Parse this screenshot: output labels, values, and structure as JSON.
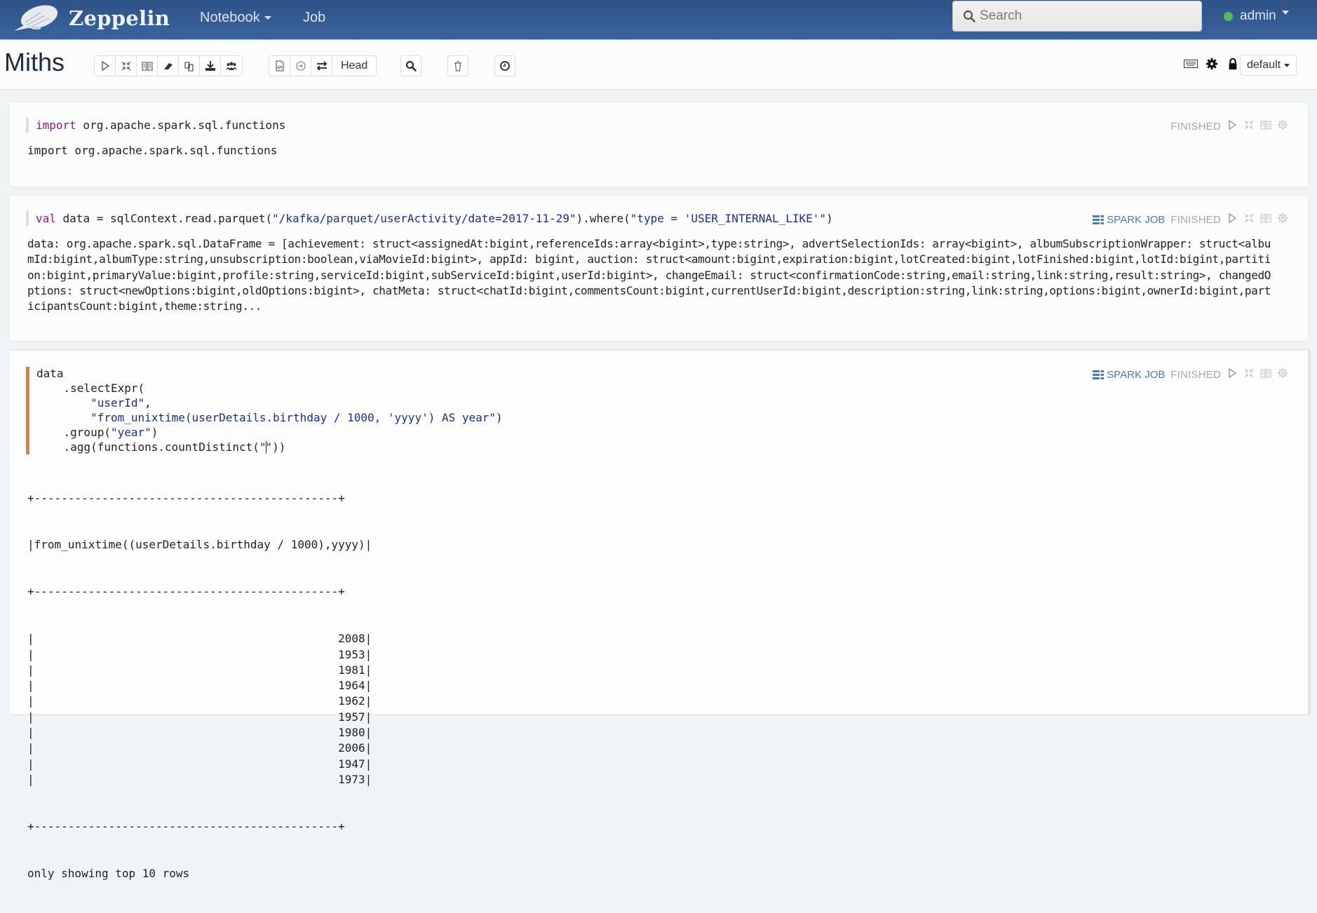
{
  "navbar": {
    "brand": "Zeppelin",
    "menu": [
      {
        "label": "Notebook",
        "has_dropdown": true
      },
      {
        "label": "Job",
        "has_dropdown": false
      }
    ],
    "search": {
      "placeholder": "Search",
      "value": ""
    },
    "user": {
      "name": "admin",
      "status_color": "#5cb85c"
    }
  },
  "notebook": {
    "title": "Miths",
    "toolbar": {
      "group1": [
        "run-all-icon",
        "collapse-icon",
        "book-icon",
        "eraser-icon",
        "copy-icon",
        "download-icon",
        "users-icon"
      ],
      "group2": [
        "code-file-icon",
        "commit-icon",
        "swap-icon"
      ],
      "head_label": "Head",
      "search_icon": "search-icon",
      "delete_icon": "trash-icon",
      "schedule_icon": "clock-icon"
    },
    "right_tools": [
      "keyboard-icon",
      "gear-icon",
      "lock-icon"
    ],
    "interpreter_select": "default"
  },
  "paragraphs": [
    {
      "code": "import org.apache.spark.sql.functions",
      "code_keyword": "import",
      "code_rest": " org.apache.spark.sql.functions",
      "output": "import org.apache.spark.sql.functions",
      "status": "FINISHED",
      "spark_job": null
    },
    {
      "code_keyword": "val",
      "code_pre": " data = sqlContext.read.parquet(",
      "code_str1": "\"/kafka/parquet/userActivity/date=2017-11-29\"",
      "code_mid": ").where(",
      "code_str2": "\"type = 'USER_INTERNAL_LIKE'\"",
      "code_post": ")",
      "output_lines": [
        "data: org.apache.spark.sql.DataFrame = [achievement: struct<assignedAt:bigint,referenceIds:array<bigint>,type:string>, advertSelectionIds: array<bigint>, albumSubscriptionWrapper: struct<albu",
        "mId:bigint,albumType:string,unsubscription:boolean,viaMovieId:bigint>, appId: bigint, auction: struct<amount:bigint,expiration:bigint,lotCreated:bigint,lotFinished:bigint,lotId:bigint,partiti",
        "on:bigint,primaryValue:bigint,profile:string,serviceId:bigint,subServiceId:bigint,userId:bigint>, changeEmail: struct<confirmationCode:string,email:string,link:string,result:string>, changedO",
        "ptions: struct<newOptions:bigint,oldOptions:bigint>, chatMeta: struct<chatId:bigint,commentsCount:bigint,currentUserId:bigint,description:string,link:string,options:bigint,ownerId:bigint,part",
        "icipantsCount:bigint,theme:string..."
      ],
      "status": "FINISHED",
      "spark_job": "SPARK JOB"
    },
    {
      "code_lines": [
        {
          "plain": "data"
        },
        {
          "plain": "    .selectExpr("
        },
        {
          "str": "        \"userId\"",
          "plain_after": ","
        },
        {
          "str": "        \"from_unixtime(userDetails.birthday / 1000, 'yyyy') AS year\"",
          "plain_after": ")"
        },
        {
          "plain": "    .group(",
          "str": "\"year\"",
          "plain_after": ")"
        },
        {
          "plain": "    .agg(functions.countDistinct(",
          "str_a": "\"",
          "str_b": "\"",
          "plain_after": "))"
        }
      ],
      "table": {
        "border": "+---------------------------------------------+",
        "header": "from_unixtime((userDetails.birthday / 1000),yyyy)",
        "rows": [
          "2008",
          "1953",
          "1981",
          "1964",
          "1962",
          "1957",
          "1980",
          "2006",
          "1947",
          "1973"
        ],
        "footer": "only showing top 10 rows"
      },
      "status": "FINISHED",
      "spark_job": "SPARK JOB"
    }
  ]
}
